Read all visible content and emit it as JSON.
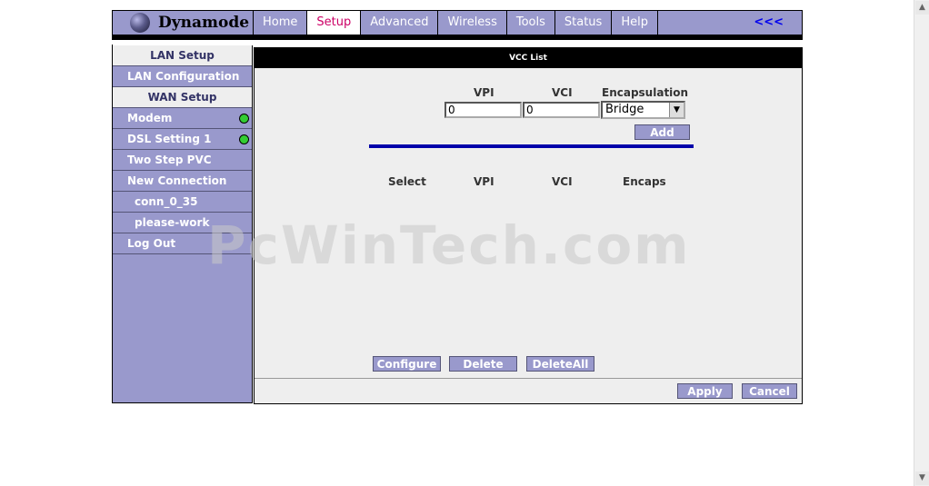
{
  "brand": {
    "name": "Dynamode"
  },
  "nav": {
    "items": [
      "Home",
      "Setup",
      "Advanced",
      "Wireless",
      "Tools",
      "Status",
      "Help"
    ],
    "active": "Setup",
    "collapse": "<<<"
  },
  "sidebar": {
    "items": [
      {
        "label": "LAN Setup",
        "kind": "header"
      },
      {
        "label": "LAN Configuration",
        "kind": "item"
      },
      {
        "label": "WAN Setup",
        "kind": "header"
      },
      {
        "label": "Modem",
        "kind": "item",
        "status": "green"
      },
      {
        "label": "DSL Setting 1",
        "kind": "item",
        "status": "green"
      },
      {
        "label": "Two Step PVC",
        "kind": "item"
      },
      {
        "label": "New Connection",
        "kind": "item"
      },
      {
        "label": "conn_0_35",
        "kind": "sub"
      },
      {
        "label": "please-work",
        "kind": "sub"
      },
      {
        "label": "Log Out",
        "kind": "item"
      }
    ]
  },
  "content": {
    "title": "VCC List",
    "form": {
      "vpi_label": "VPI",
      "vci_label": "VCI",
      "encap_label": "Encapsulation",
      "vpi_value": "0",
      "vci_value": "0",
      "encap_value": "Bridge",
      "add_label": "Add"
    },
    "table": {
      "headers": [
        "Select",
        "VPI",
        "VCI",
        "Encaps"
      ]
    },
    "actions": {
      "configure": "Configure",
      "delete": "Delete",
      "delete_all": "DeleteAll"
    },
    "footer": {
      "apply": "Apply",
      "cancel": "Cancel"
    }
  },
  "watermark": "PcWinTech.com",
  "colors": {
    "nav_bg": "#9999cc",
    "active_text": "#cc0066",
    "blue_line": "#0000aa",
    "led": "#33cc33"
  }
}
